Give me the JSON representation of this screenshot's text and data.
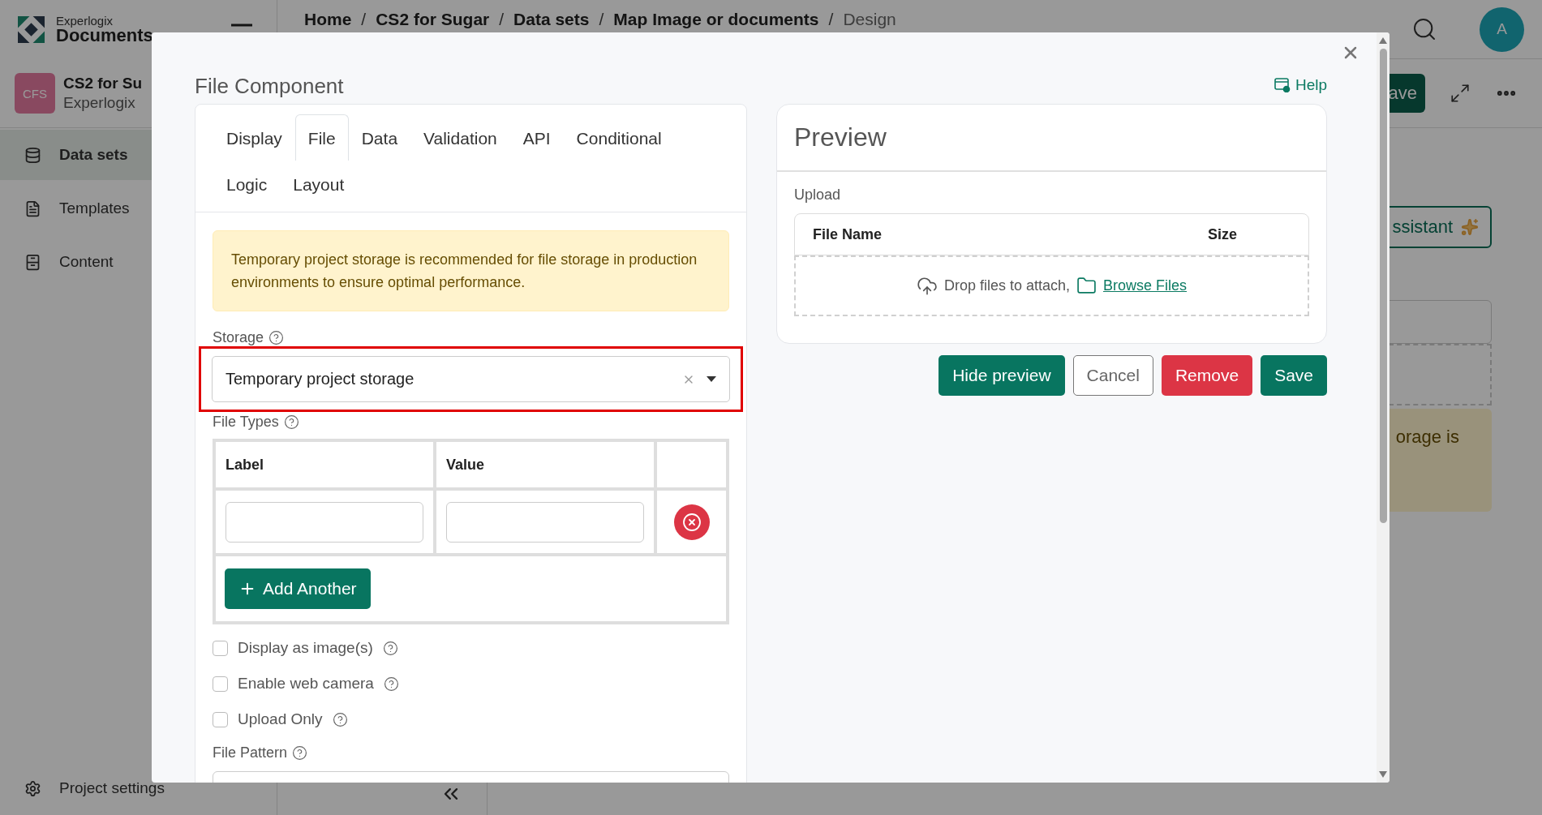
{
  "app": {
    "logo": {
      "line1": "Experlogix",
      "line2": "Documents"
    },
    "breadcrumb": {
      "items": [
        "Home",
        "CS2 for Sugar",
        "Data sets",
        "Map Image or documents",
        "Design"
      ],
      "separators": [
        "/",
        "/",
        "/",
        "/"
      ]
    },
    "avatar": "A"
  },
  "project": {
    "badge": "CFS",
    "name": "CS2 for Su",
    "org": "Experlogix"
  },
  "sidebar": {
    "items": [
      {
        "label": "Data sets",
        "selected": true
      },
      {
        "label": "Templates",
        "selected": false
      },
      {
        "label": "Content",
        "selected": false
      }
    ],
    "footer": "Project settings"
  },
  "background": {
    "save_button": "ave",
    "assistant_button": "ssistant",
    "note": "orage is"
  },
  "modal": {
    "title": "File Component",
    "help": "Help",
    "tabs": [
      {
        "label": "Display",
        "selected": false
      },
      {
        "label": "File",
        "selected": true
      },
      {
        "label": "Data",
        "selected": false
      },
      {
        "label": "Validation",
        "selected": false
      },
      {
        "label": "API",
        "selected": false
      },
      {
        "label": "Conditional",
        "selected": false
      },
      {
        "label": "Logic",
        "selected": false
      },
      {
        "label": "Layout",
        "selected": false
      }
    ],
    "alert": "Temporary project storage is recommended for file storage in production environments to ensure optimal performance.",
    "storage": {
      "label": "Storage",
      "value": "Temporary project storage",
      "highlighted": true
    },
    "file_types": {
      "label": "File Types",
      "columns": [
        "Label",
        "Value"
      ],
      "add_button": "Add Another"
    },
    "options": [
      {
        "label": "Display as image(s)",
        "checked": false
      },
      {
        "label": "Enable web camera",
        "checked": false
      },
      {
        "label": "Upload Only",
        "checked": false
      }
    ],
    "file_pattern": {
      "label": "File Pattern"
    },
    "preview": {
      "title": "Preview",
      "upload_label": "Upload",
      "columns": [
        "File Name",
        "Size"
      ],
      "drop_text": "Drop files to attach,",
      "browse": "Browse Files"
    },
    "buttons": [
      {
        "label": "Hide preview",
        "kind": "primary"
      },
      {
        "label": "Cancel",
        "kind": "outline"
      },
      {
        "label": "Remove",
        "kind": "danger"
      },
      {
        "label": "Save",
        "kind": "primary"
      }
    ]
  }
}
